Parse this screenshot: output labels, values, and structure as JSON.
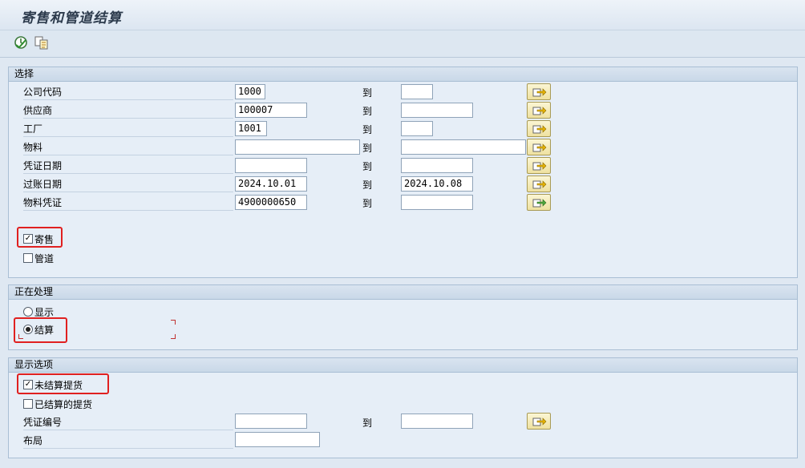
{
  "app": {
    "title": "寄售和管道结算"
  },
  "toolbar": {
    "execute_icon": "execute-clock-icon",
    "variant_icon": "get-variant-icon"
  },
  "selection": {
    "header": "选择",
    "to_label": "到",
    "rows": [
      {
        "label": "公司代码",
        "from": "1000",
        "to": ""
      },
      {
        "label": "供应商",
        "from": "100007",
        "to": ""
      },
      {
        "label": "工厂",
        "from": "1001",
        "to": ""
      },
      {
        "label": "物料",
        "from": "",
        "to": ""
      },
      {
        "label": "凭证日期",
        "from": "",
        "to": ""
      },
      {
        "label": "过账日期",
        "from": "2024.10.01",
        "to": "2024.10.08"
      },
      {
        "label": "物料凭证",
        "from": "4900000650",
        "to": ""
      }
    ],
    "consignment": {
      "label": "寄售",
      "checked": true
    },
    "pipeline": {
      "label": "管道",
      "checked": false
    }
  },
  "processing": {
    "header": "正在处理",
    "options": [
      {
        "label": "显示",
        "selected": false
      },
      {
        "label": "结算",
        "selected": true
      }
    ]
  },
  "display_options": {
    "header": "显示选项",
    "unsettled": {
      "label": "未结算提货",
      "checked": true
    },
    "settled": {
      "label": "已结算的提货",
      "checked": false
    },
    "doc_number": {
      "label": "凭证编号",
      "from": "",
      "to": ""
    },
    "layout": {
      "label": "布局",
      "value": ""
    }
  },
  "colors": {
    "highlight": "#e02020",
    "background": "#dfe8f2",
    "group_header": "#c9d8e8"
  }
}
